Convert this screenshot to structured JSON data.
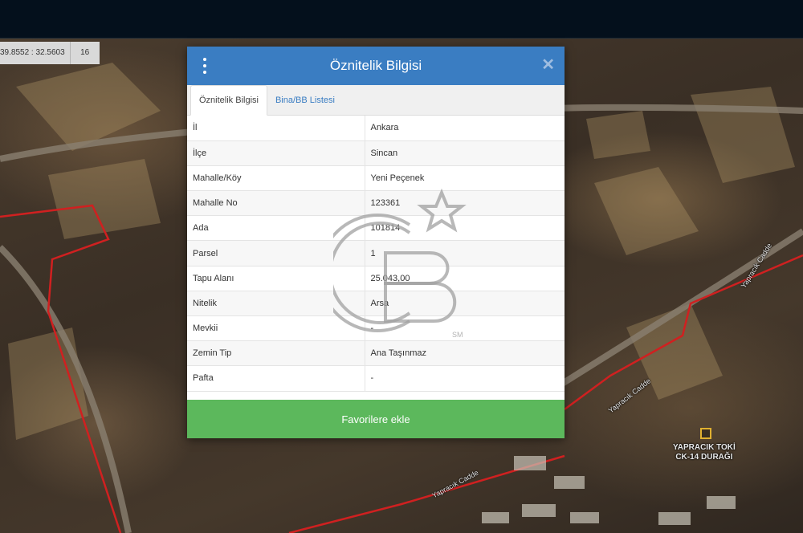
{
  "topbar": {},
  "map": {
    "coords": "39.8552 : 32.5603",
    "zoom": "16",
    "labels": {
      "bus_stop": "YAPRACIK TOKİ\nCK-14 DURAĞI",
      "street_east": "Yapracık Cadde",
      "street_north": "Yapracık Cadde",
      "street_south": "Yapracık Cadde"
    }
  },
  "dialog": {
    "title": "Öznitelik Bilgisi",
    "tabs": [
      {
        "label": "Öznitelik Bilgisi",
        "active": true
      },
      {
        "label": "Bina/BB Listesi",
        "active": false
      }
    ],
    "rows": [
      {
        "key": "İl",
        "value": "Ankara"
      },
      {
        "key": "İlçe",
        "value": "Sincan"
      },
      {
        "key": "Mahalle/Köy",
        "value": "Yeni Peçenek"
      },
      {
        "key": "Mahalle No",
        "value": "123361"
      },
      {
        "key": "Ada",
        "value": "101814"
      },
      {
        "key": "Parsel",
        "value": "1"
      },
      {
        "key": "Tapu Alanı",
        "value": "25.043,00"
      },
      {
        "key": "Nitelik",
        "value": "Arsa"
      },
      {
        "key": "Mevkii",
        "value": "-"
      },
      {
        "key": "Zemin Tip",
        "value": "Ana Taşınmaz"
      },
      {
        "key": "Pafta",
        "value": "-"
      }
    ],
    "favorite_button": "Favorilere ekle"
  },
  "watermark": {
    "text": "SM"
  },
  "colors": {
    "header": "#3a7dc2",
    "button": "#5cb85c",
    "parcel_border": "#d02020",
    "topbar": "#04101c"
  }
}
